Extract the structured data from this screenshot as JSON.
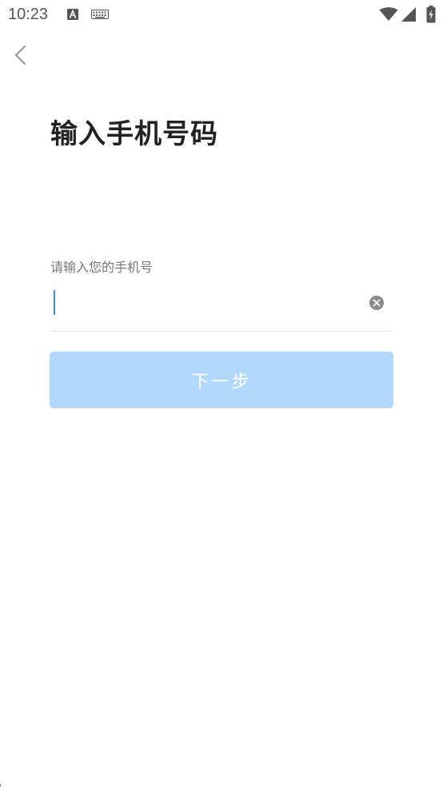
{
  "status_bar": {
    "time": "10:23",
    "icons": [
      "a-notification-icon",
      "keyboard-icon",
      "wifi-icon",
      "signal-icon",
      "battery-icon"
    ]
  },
  "header": {
    "back_icon": "chevron-left-icon"
  },
  "main": {
    "title": "输入手机号码",
    "phone_label": "请输入您的手机号",
    "phone_value": "",
    "clear_icon": "clear-circle-icon",
    "next_label": "下一步"
  },
  "colors": {
    "primary_disabled": "#b3d8fd",
    "caret": "#3a8ee6",
    "title": "#222222",
    "label": "#777777",
    "divider": "#e4e4e4"
  }
}
